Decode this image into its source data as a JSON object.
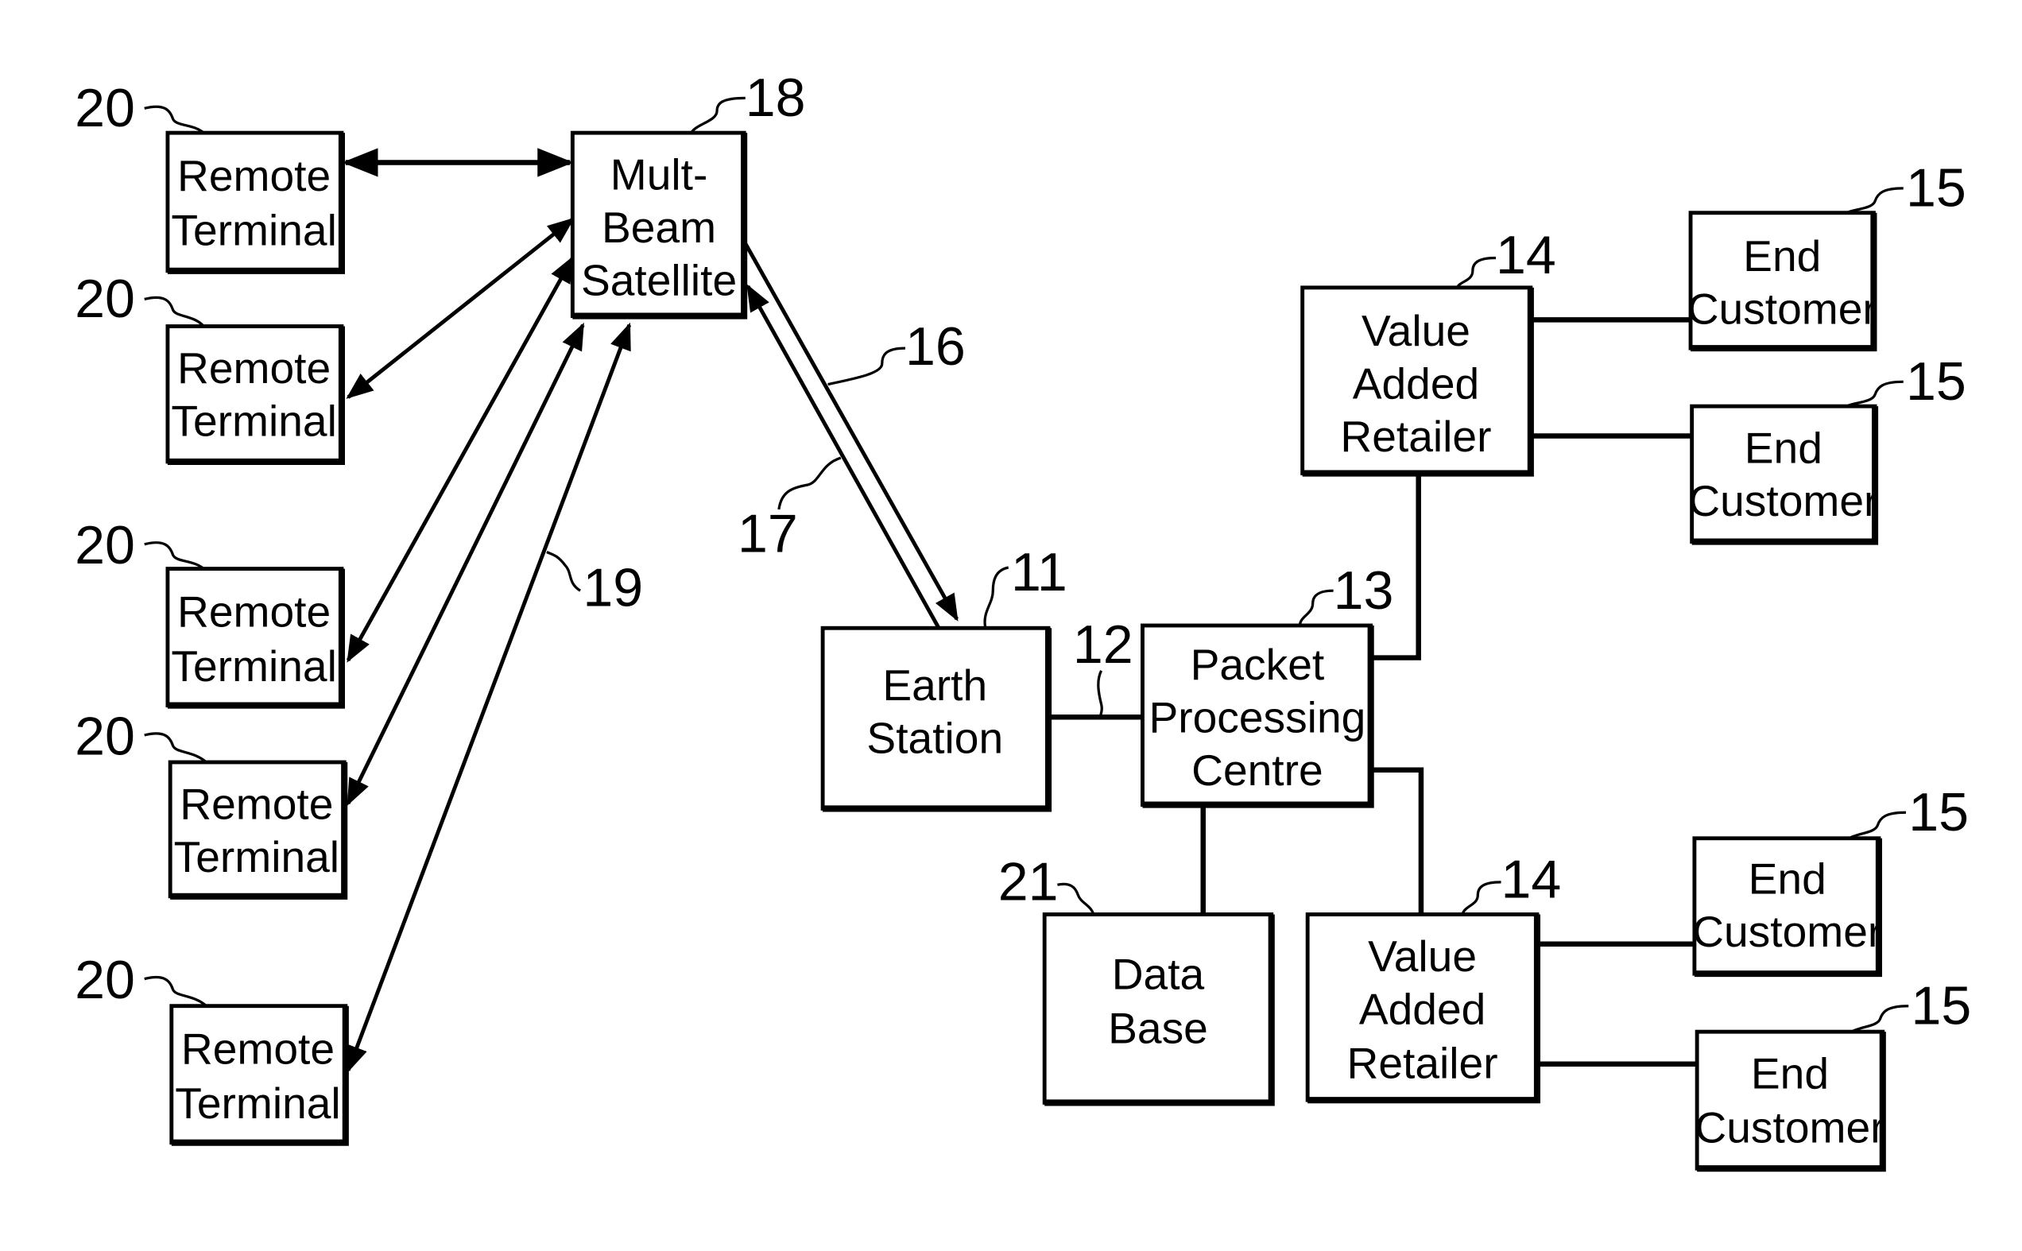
{
  "figure": {
    "blocks": {
      "satellite": {
        "ref": "18",
        "lines": [
          "Mult-",
          "Beam",
          "Satellite"
        ]
      },
      "earth_station": {
        "ref": "11",
        "lines": [
          "Earth",
          "Station"
        ]
      },
      "packet_processing": {
        "ref": "13",
        "lines": [
          "Packet",
          "Processing",
          "Centre"
        ]
      },
      "data_base": {
        "ref": "21",
        "lines": [
          "Data",
          "Base"
        ]
      },
      "var_top": {
        "ref": "14",
        "lines": [
          "Value",
          "Added",
          "Retailer"
        ]
      },
      "var_bottom": {
        "ref": "14",
        "lines": [
          "Value",
          "Added",
          "Retailer"
        ]
      },
      "remote_terminals": [
        {
          "ref": "20",
          "lines": [
            "Remote",
            "Terminal"
          ]
        },
        {
          "ref": "20",
          "lines": [
            "Remote",
            "Terminal"
          ]
        },
        {
          "ref": "20",
          "lines": [
            "Remote",
            "Terminal"
          ]
        },
        {
          "ref": "20",
          "lines": [
            "Remote",
            "Terminal"
          ]
        },
        {
          "ref": "20",
          "lines": [
            "Remote",
            "Terminal"
          ]
        }
      ],
      "end_customers": [
        {
          "ref": "15",
          "lines": [
            "End",
            "Customer"
          ]
        },
        {
          "ref": "15",
          "lines": [
            "End",
            "Customer"
          ]
        },
        {
          "ref": "15",
          "lines": [
            "End",
            "Customer"
          ]
        },
        {
          "ref": "15",
          "lines": [
            "End",
            "Customer"
          ]
        }
      ]
    },
    "link_refs": {
      "uplink": "16",
      "downlink": "17",
      "terminal_links": "19",
      "earth_to_ppc": "12"
    }
  }
}
